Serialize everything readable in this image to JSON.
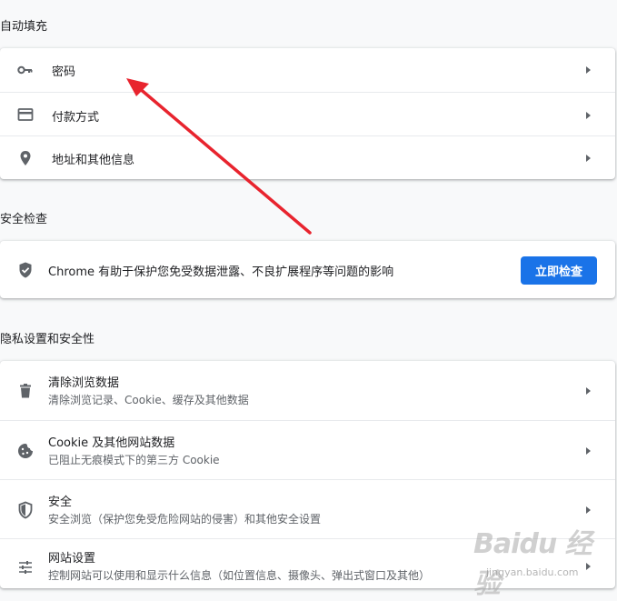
{
  "autofill": {
    "title": "自动填充",
    "items": [
      {
        "label": "密码",
        "icon": "key-icon"
      },
      {
        "label": "付款方式",
        "icon": "credit-card-icon"
      },
      {
        "label": "地址和其他信息",
        "icon": "location-pin-icon"
      }
    ]
  },
  "safety_check": {
    "title": "安全检查",
    "description": "Chrome 有助于保护您免受数据泄露、不良扩展程序等问题的影响",
    "button_label": "立即检查",
    "icon": "shield-check-icon"
  },
  "privacy": {
    "title": "隐私设置和安全性",
    "items": [
      {
        "label": "清除浏览数据",
        "sublabel": "清除浏览记录、Cookie、缓存及其他数据",
        "icon": "trash-icon"
      },
      {
        "label": "Cookie 及其他网站数据",
        "sublabel": "已阻止无痕模式下的第三方 Cookie",
        "icon": "cookie-icon"
      },
      {
        "label": "安全",
        "sublabel": "安全浏览（保护您免受危险网站的侵害）和其他安全设置",
        "icon": "shield-icon"
      },
      {
        "label": "网站设置",
        "sublabel": "控制网站可以使用和显示什么信息（如位置信息、摄像头、弹出式窗口及其他）",
        "icon": "tune-icon"
      }
    ]
  },
  "watermark": {
    "logo": "Baidu 经验",
    "url": "jingyan.baidu.com"
  },
  "colors": {
    "accent": "#1a73e8",
    "annotation_arrow": "#e8242e",
    "background": "#f8f9fa",
    "card": "#ffffff"
  }
}
